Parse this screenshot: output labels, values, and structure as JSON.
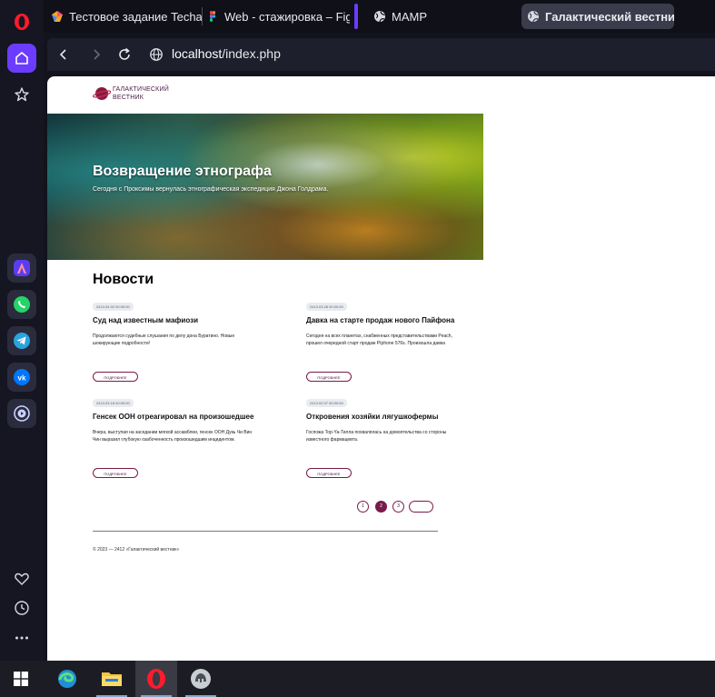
{
  "browser": {
    "tabs": [
      {
        "title": "Тестовое задание Techart",
        "icon": "colorful-app-icon"
      },
      {
        "title": "Web - стажировка – Figm",
        "icon": "figma-icon"
      },
      {
        "title": "MAMP",
        "icon": "globe-icon"
      },
      {
        "title": "Галактический вестник",
        "icon": "globe-icon",
        "active": true
      }
    ],
    "new_tab_label": "+",
    "url_host": "localhost",
    "url_path": "/index.php"
  },
  "site": {
    "logo_line1": "ГАЛАКТИЧЕСКИЙ",
    "logo_line2": "ВЕСТНИК",
    "hero_title": "Возвращение этнографа",
    "hero_subtitle": "Сегодня с Проксимы вернулась этнографическая экспедиция Джона Голдрама.",
    "news_title": "Новости",
    "news": [
      {
        "date": "2413.04.02 00:00:00",
        "title": "Суд над известным мафиози",
        "text": "Продолжаются судебные слушания по делу дона Буратино. Новые шокирующие подробности!",
        "button": "ПОДРОБНЕЕ"
      },
      {
        "date": "2413.03.28 00:00:00",
        "title": "Давка на старте продаж нового Пайфона",
        "text": "Сегодня на всех планетах, снабженных представительствами Peach, прошел очередной старт продаж Pìphone 576s. Произошла давка",
        "button": "ПОДРОБНЕЕ"
      },
      {
        "date": "2413.03.18 00:00:00",
        "title": "Генсек ООН отреагировал на произошедшее",
        "text": "Вчера, выступая на заседании мягкой ассамблеи, генсек ООН Дукь Чи Вин Чин выразил глубокую озабоченность произошедшим инцидентом.",
        "button": "ПОДРОБНЕЕ"
      },
      {
        "date": "2413.02.07 00:00:00",
        "title": "Откровения хозяйки лягушкофермы",
        "text": "Госпожа Тор-Ya-Тилла похвалялась на домоятельства со стороны известного фармацевта.",
        "button": "ПОДРОБНЕЕ"
      }
    ],
    "pagination": [
      "1",
      "2",
      "3"
    ],
    "footer": "© 2023 — 2412 «Галактический вестник»"
  },
  "colors": {
    "accent": "#7a1a4a",
    "opera_red": "#ff1b2d",
    "sidebar_active": "#6b3cff"
  }
}
